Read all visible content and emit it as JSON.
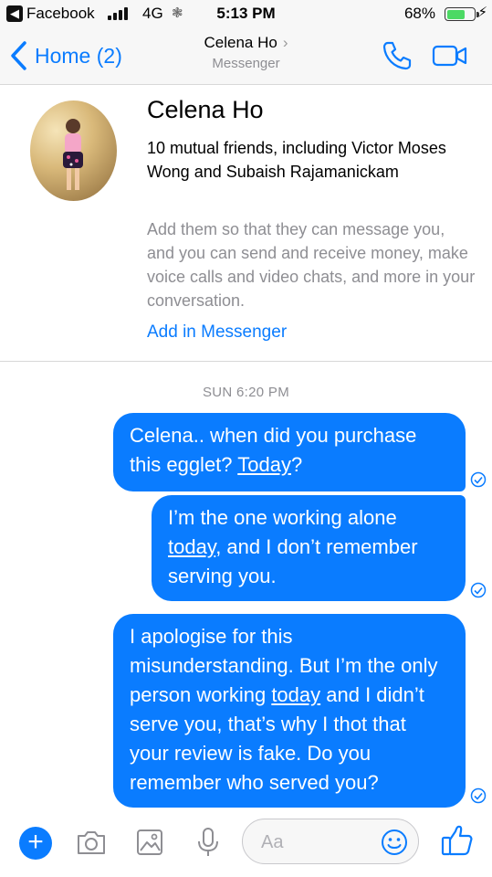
{
  "status_bar": {
    "back_app": "Facebook",
    "network": "4G",
    "time": "5:13 PM",
    "battery": "68%",
    "battery_level": 0.68
  },
  "nav": {
    "back_label": "Home (2)",
    "title": "Celena Ho",
    "subtitle": "Messenger",
    "accent_color": "#0a7cff"
  },
  "profile": {
    "name": "Celena Ho",
    "mutual": "10 mutual friends, including Victor Moses Wong and Subaish Rajamanickam",
    "info": "Add them so that they can message you, and you can send and receive money, make voice calls and video chats, and more in your conversation.",
    "add_link": "Add in Messenger"
  },
  "chat": {
    "timestamp": "SUN 6:20 PM",
    "messages": [
      {
        "before": "Celena.. when did you purchase this egglet? ",
        "link": "Today",
        "after": "?"
      },
      {
        "before": "I’m the one working alone ",
        "link": "today",
        "after": ", and I don’t remember serving you."
      },
      {
        "before": "I apologise for this misunderstanding. But I’m the only person working ",
        "link": "today",
        "after": " and I didn’t serve you, that’s why I thot that your review is fake. Do you remember who served you?"
      }
    ]
  },
  "composer": {
    "placeholder": "Aa"
  }
}
